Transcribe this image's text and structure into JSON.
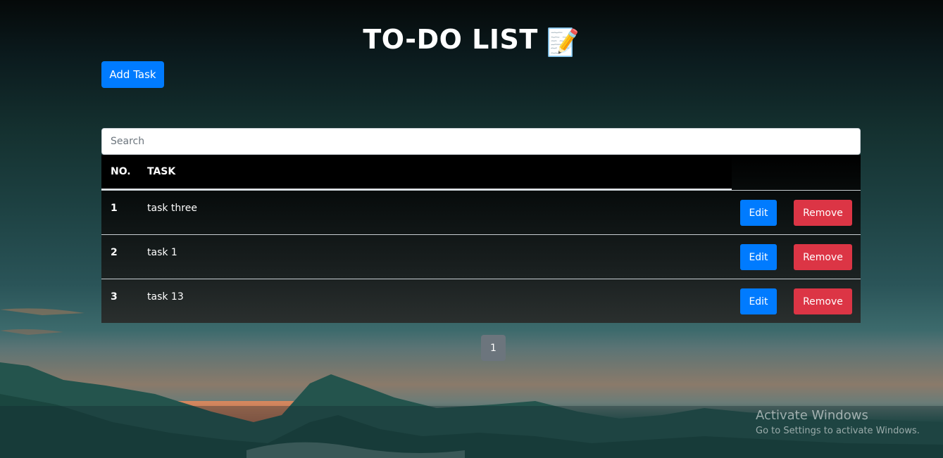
{
  "header": {
    "title": "TO-DO LIST",
    "title_emoji": "📝"
  },
  "toolbar": {
    "add_task_label": "Add Task"
  },
  "search": {
    "placeholder": "Search",
    "value": ""
  },
  "table": {
    "columns": [
      "NO.",
      "TASK"
    ],
    "rows": [
      {
        "no": "1",
        "task": "task three",
        "edit_label": "Edit",
        "remove_label": "Remove"
      },
      {
        "no": "2",
        "task": "task 1",
        "edit_label": "Edit",
        "remove_label": "Remove"
      },
      {
        "no": "3",
        "task": "task 13",
        "edit_label": "Edit",
        "remove_label": "Remove"
      }
    ]
  },
  "pagination": {
    "current_page": "1"
  },
  "watermark": {
    "line1": "Activate Windows",
    "line2": "Go to Settings to activate Windows."
  },
  "colors": {
    "primary": "#007bff",
    "danger": "#dc3545",
    "secondary": "#6c757d"
  }
}
